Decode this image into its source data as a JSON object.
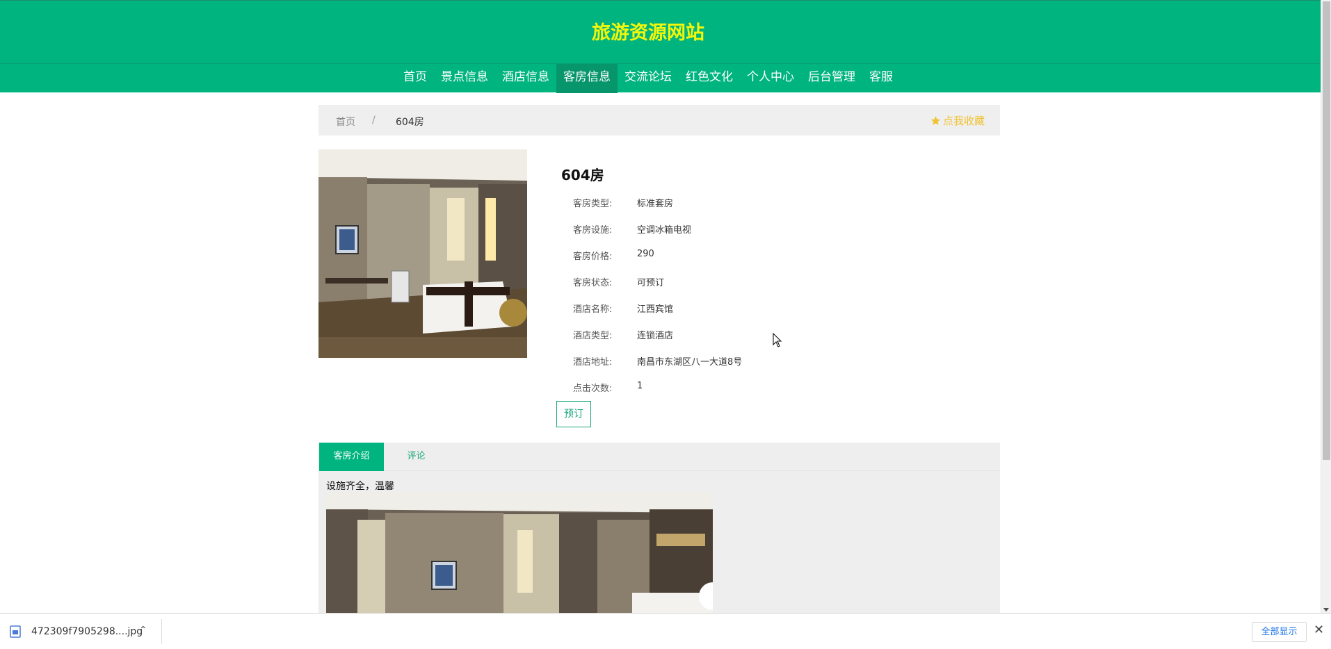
{
  "header": {
    "site_title": "旅游资源网站",
    "nav": [
      "首页",
      "景点信息",
      "酒店信息",
      "客房信息",
      "交流论坛",
      "红色文化",
      "个人中心",
      "后台管理",
      "客服"
    ],
    "active_nav": "客房信息"
  },
  "breadcrumb": {
    "home": "首页",
    "separator": "/",
    "current": "604房",
    "favorite_icon": "star-icon",
    "favorite_label": "点我收藏"
  },
  "room": {
    "title": "604房",
    "details": [
      {
        "label": "客房类型:",
        "value": "标准套房"
      },
      {
        "label": "客房设施:",
        "value": "空调冰箱电视"
      },
      {
        "label": "客房价格:",
        "value": "290"
      },
      {
        "label": "客房状态:",
        "value": "可预订"
      },
      {
        "label": "酒店名称:",
        "value": "江西宾馆"
      },
      {
        "label": "酒店类型:",
        "value": "连锁酒店"
      },
      {
        "label": "酒店地址:",
        "value": "南昌市东湖区八一大道8号"
      },
      {
        "label": "点击次数:",
        "value": "1"
      }
    ],
    "book_label": "预订"
  },
  "tabs": {
    "items": [
      "客房介绍",
      "评论"
    ],
    "active": "客房介绍",
    "intro_text": "设施齐全，温馨"
  },
  "download_bar": {
    "file_name": "472309f7905298....jpg",
    "show_all": "全部显示",
    "file_icon": "image-file-icon",
    "chevron_icon": "chevron-up-icon",
    "close_icon": "close-icon"
  },
  "colors": {
    "brand_green": "#00b47f",
    "title_yellow": "#f3f70a",
    "favorite_gold": "#f1c230"
  }
}
